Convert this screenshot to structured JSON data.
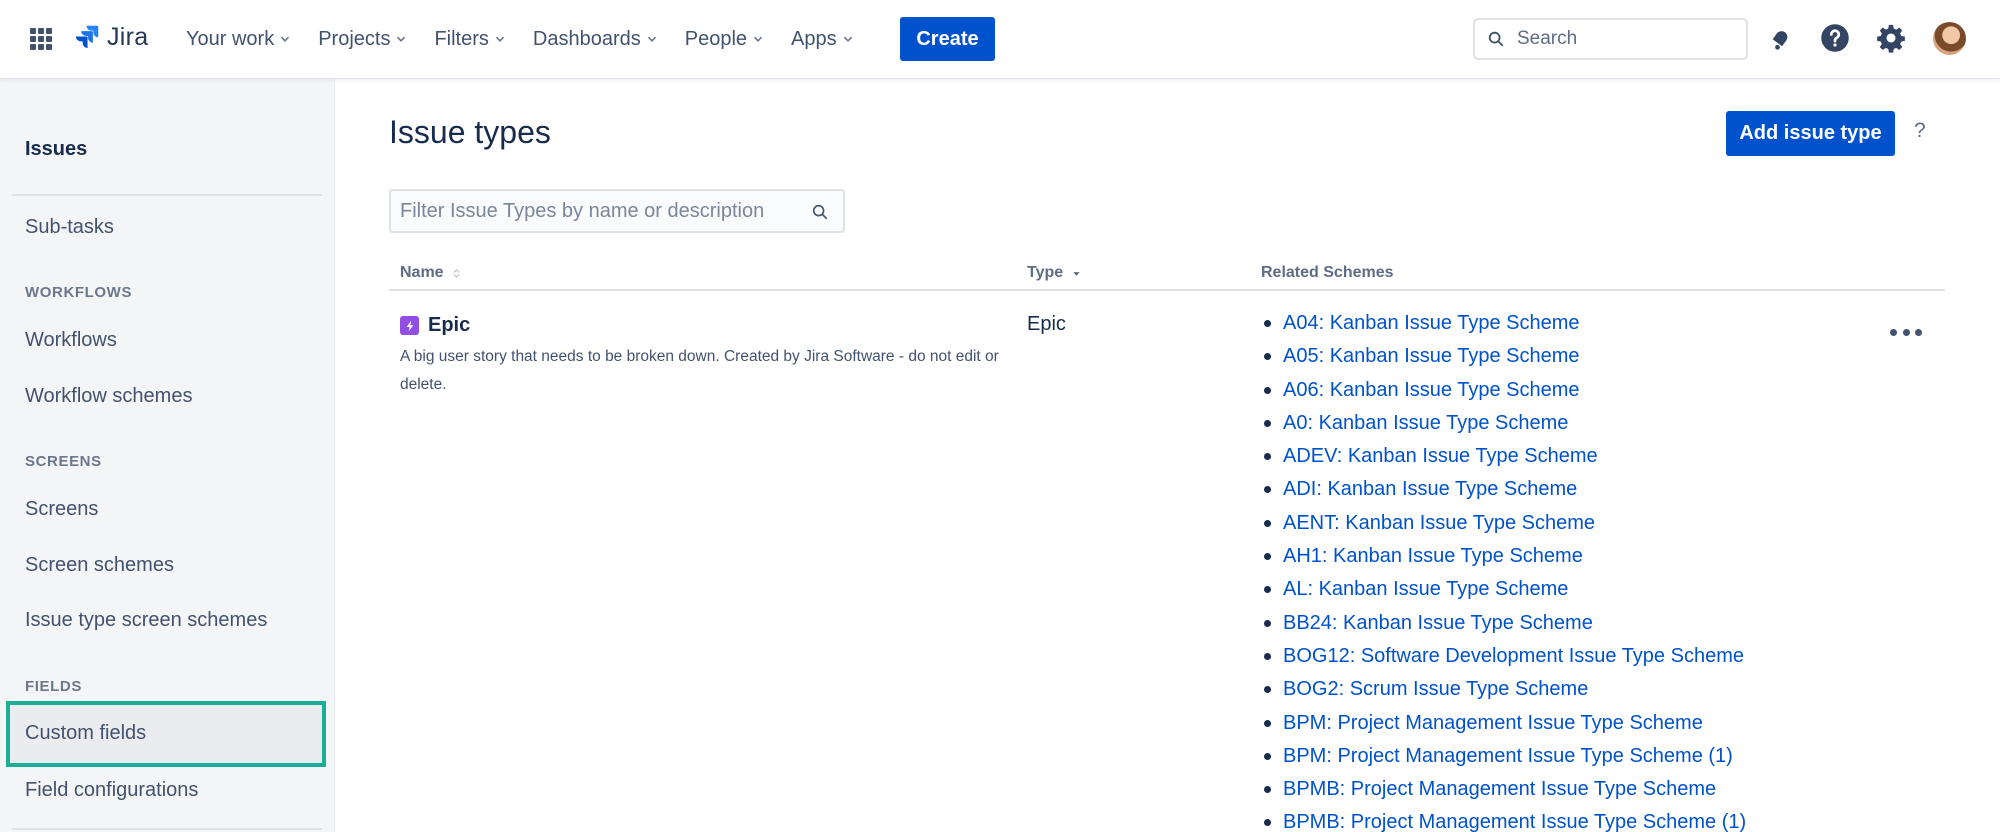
{
  "nav": {
    "product": "Jira",
    "menu": [
      {
        "label": "Your work"
      },
      {
        "label": "Projects"
      },
      {
        "label": "Filters"
      },
      {
        "label": "Dashboards"
      },
      {
        "label": "People"
      },
      {
        "label": "Apps"
      }
    ],
    "create_label": "Create",
    "search_placeholder": "Search",
    "icons": [
      "notifications-icon",
      "help-icon",
      "settings-icon",
      "avatar"
    ]
  },
  "sidebar": {
    "title": "Issues",
    "items_top": [
      "Sub-tasks"
    ],
    "workflows_heading": "WORKFLOWS",
    "workflows_items": [
      "Workflows",
      "Workflow schemes"
    ],
    "screens_heading": "SCREENS",
    "screens_items": [
      "Screens",
      "Screen schemes",
      "Issue type screen schemes"
    ],
    "fields_heading": "FIELDS",
    "fields_items": [
      "Custom fields",
      "Field configurations"
    ]
  },
  "main": {
    "title": "Issue types",
    "add_label": "Add issue type",
    "help": "?",
    "filter_placeholder": "Filter Issue Types by name or description",
    "columns": {
      "name": "Name",
      "type": "Type",
      "schemes": "Related Schemes"
    },
    "row": {
      "name": "Epic",
      "description": "A big user story that needs to be broken down. Created by Jira Software - do not edit or delete.",
      "type": "Epic",
      "schemes": [
        "A04: Kanban Issue Type Scheme",
        "A05: Kanban Issue Type Scheme",
        "A06: Kanban Issue Type Scheme",
        "A0: Kanban Issue Type Scheme",
        "ADEV: Kanban Issue Type Scheme",
        "ADI: Kanban Issue Type Scheme",
        "AENT: Kanban Issue Type Scheme",
        "AH1: Kanban Issue Type Scheme",
        "AL: Kanban Issue Type Scheme",
        "BB24: Kanban Issue Type Scheme",
        "BOG12: Software Development Issue Type Scheme",
        "BOG2: Scrum Issue Type Scheme",
        "BPM: Project Management Issue Type Scheme",
        "BPM: Project Management Issue Type Scheme (1)",
        "BPMB: Project Management Issue Type Scheme",
        "BPMB: Project Management Issue Type Scheme (1)"
      ]
    }
  },
  "colors": {
    "brand_blue": "#0052CC",
    "epic_purple": "#904EE2",
    "highlight_teal": "#1BAE96"
  }
}
